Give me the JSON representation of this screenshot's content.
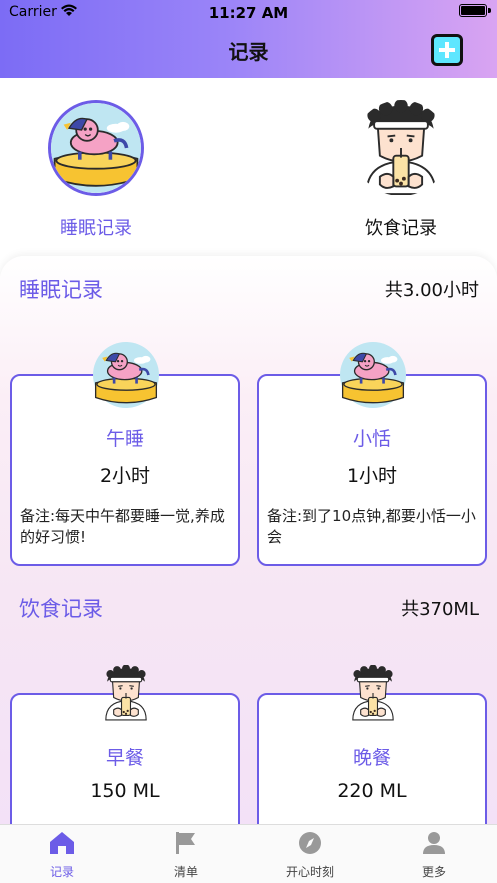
{
  "status_bar": {
    "carrier": "Carrier",
    "time": "11:27 AM"
  },
  "nav": {
    "title": "记录",
    "add_icon": "plus-square-icon"
  },
  "selectors": [
    {
      "label": "睡眠记录",
      "icon": "unicorn-float-icon",
      "selected": true
    },
    {
      "label": "饮食记录",
      "icon": "boba-boy-icon",
      "selected": false
    }
  ],
  "sleep": {
    "title": "睡眠记录",
    "total": "共3.00小时",
    "cards": [
      {
        "title": "午睡",
        "value": "2小时",
        "note": "备注:每天中午都要睡一觉,养成的好习惯!"
      },
      {
        "title": "小恬",
        "value": "1小时",
        "note": "备注:到了10点钟,都要小恬一小会"
      }
    ]
  },
  "food": {
    "title": "饮食记录",
    "total": "共370ML",
    "cards": [
      {
        "title": "早餐",
        "value": "150 ML"
      },
      {
        "title": "晚餐",
        "value": "220 ML"
      }
    ]
  },
  "tabs": [
    {
      "label": "记录",
      "icon": "home-icon",
      "active": true
    },
    {
      "label": "清单",
      "icon": "flag-icon",
      "active": false
    },
    {
      "label": "开心时刻",
      "icon": "compass-icon",
      "active": false
    },
    {
      "label": "更多",
      "icon": "person-icon",
      "active": false
    }
  ],
  "colors": {
    "accent": "#6c5ce7",
    "header_start": "#7c6cf5",
    "header_end": "#d9a4f2"
  }
}
